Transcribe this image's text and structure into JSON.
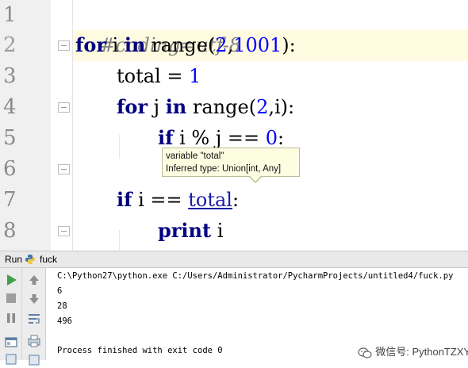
{
  "editor": {
    "line_numbers": [
      "1",
      "2",
      "3",
      "4",
      "5",
      "6",
      "7",
      "8"
    ],
    "lines": {
      "l1_comment": "#coding=utf-8",
      "l2_for": "for",
      "l2_i": " i ",
      "l2_in": "in",
      "l2_range": " range(",
      "l2_n1": "2",
      "l2_comma": ",",
      "l2_n2": "1001",
      "l2_end": "):",
      "l3_total": "total = ",
      "l3_n": "1",
      "l4_for": "for",
      "l4_j": " j ",
      "l4_in": "in",
      "l4_range": " range(",
      "l4_n": "2",
      "l4_end": ",i):",
      "l5_if": "if",
      "l5_cond": " i % j == ",
      "l5_n": "0",
      "l5_end": ":",
      "l7_if": "if",
      "l7_cond": " i == ",
      "l7_total": "total",
      "l7_end": ":",
      "l8_print": "print",
      "l8_i": " i"
    },
    "tooltip": {
      "line1": "variable \"total\"",
      "line2": "Inferred type: Union[int, Any]"
    }
  },
  "run_panel": {
    "title": "Run",
    "config_name": "fuck",
    "console_lines": [
      "C:\\Python27\\python.exe C:/Users/Administrator/PycharmProjects/untitled4/fuck.py",
      "6",
      "28",
      "496",
      "",
      "Process finished with exit code 0"
    ]
  },
  "watermark": {
    "text": "微信号: PythonTZXY"
  },
  "colors": {
    "keyword": "#000080",
    "number": "#0000ff",
    "comment": "#808080",
    "current_line": "#fffbe0",
    "tooltip_bg": "#fdfde2"
  }
}
